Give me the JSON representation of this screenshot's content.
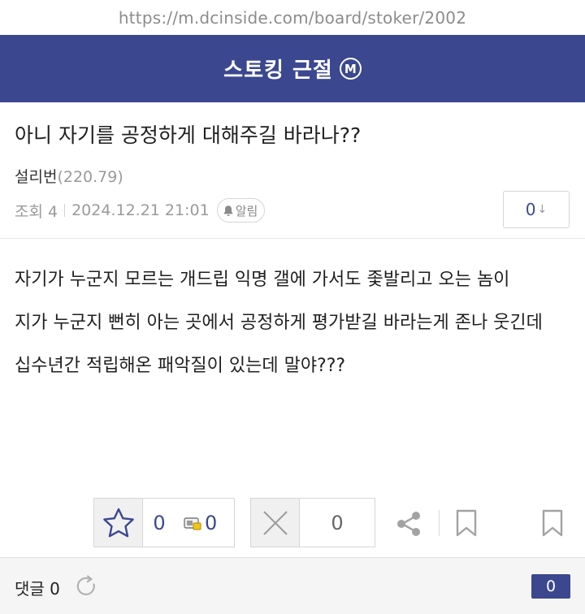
{
  "browser": {
    "url": "https://m.dcinside.com/board/stoker/2002"
  },
  "header": {
    "gallery_name": "스토킹 근절",
    "minor_badge": "M"
  },
  "post": {
    "title": "아니 자기를 공정하게 대해주길 바라나??",
    "author": "설리번",
    "author_ip": "(220.79)",
    "views": "조회 4",
    "datetime": "2024.12.21 21:01",
    "alarm_label": "알림",
    "comment_jump_count": "0",
    "comment_jump_arrow": "↓",
    "paragraphs": [
      "자기가 누군지 모르는 개드립 익명 갤에 가서도 좇발리고 오는 놈이",
      "지가 누군지 뻔히 아는 곳에서 공정하게 평가받길 바라는게 존나 웃긴데",
      "십수년간 적립해온 패악질이 있는데 말야???"
    ]
  },
  "actions": {
    "upvote_count": "0",
    "fixed_upvote_count": "0",
    "downvote_count": "0"
  },
  "footer": {
    "comment_label": "댓글 0",
    "comment_count": "0"
  },
  "colors": {
    "brand": "#3b4890",
    "muted": "#9a9a9a"
  },
  "icons": [
    "star-icon",
    "fixed-member-icon",
    "close-icon",
    "share-icon",
    "bookmark-icon",
    "bell-icon",
    "refresh-icon"
  ]
}
